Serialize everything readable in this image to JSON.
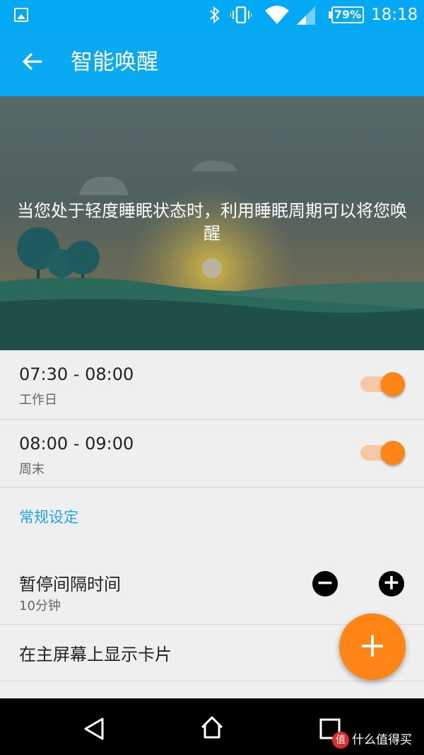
{
  "status_bar": {
    "battery": "79%",
    "time": "18:18",
    "icons": [
      "gallery-notification-icon",
      "bluetooth-icon",
      "vibrate-icon",
      "wifi-icon",
      "cell-signal-icon",
      "battery-icon"
    ]
  },
  "app_bar": {
    "title": "智能唤醒",
    "back_icon": "back-arrow-icon"
  },
  "hero": {
    "description": "当您处于轻度睡眠状态时，利用睡眠周期可以将您唤醒"
  },
  "alarms": [
    {
      "time": "07:30 - 08:00",
      "label": "工作日",
      "enabled": true
    },
    {
      "time": "08:00 - 09:00",
      "label": "周末",
      "enabled": true
    }
  ],
  "settings": {
    "header": "常规设定",
    "snooze": {
      "title": "暂停间隔时间",
      "value": "10分钟",
      "minus": "−",
      "plus": "+"
    },
    "home_card": {
      "title": "在主屏幕上显示卡片"
    }
  },
  "fab": {
    "icon": "+"
  },
  "watermark": {
    "badge": "值",
    "text": "什么值得买"
  },
  "colors": {
    "app_bar": "#03a9f4",
    "accent": "#ff8517",
    "section_header": "#1ea6ea"
  }
}
